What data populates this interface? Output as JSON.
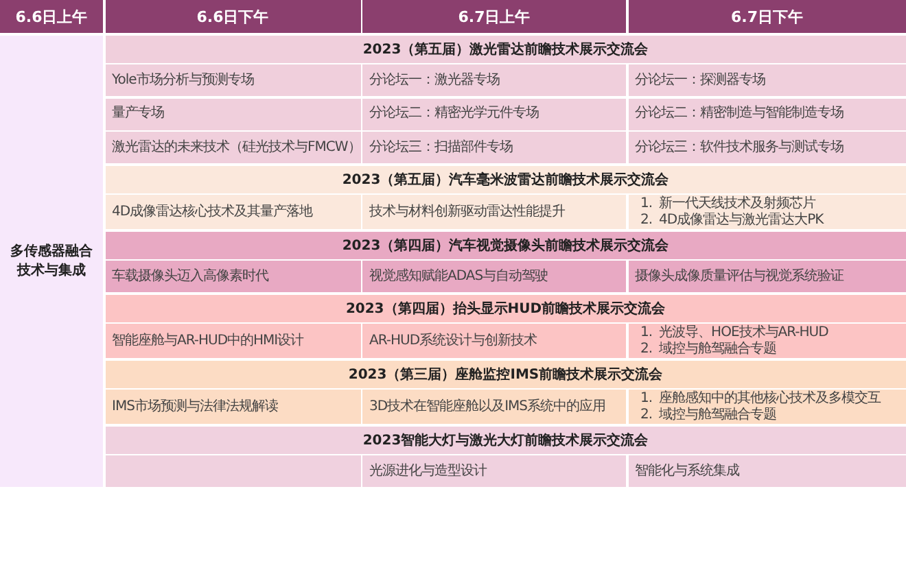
{
  "header": [
    "6.6日上午",
    "6.6日下午",
    "6.7日上午",
    "6.7日下午"
  ],
  "track": "多传感器融合技术与集成",
  "sections": [
    {
      "title": "2023（第五届）激光雷达前瞻技术展示交流会",
      "color": "#f0cfdc",
      "rows": [
        [
          {
            "kind": "text",
            "text": "Yole市场分析与预测专场"
          },
          {
            "kind": "text",
            "text": "分论坛一：激光器专场"
          },
          {
            "kind": "text",
            "text": "分论坛一：探测器专场"
          }
        ],
        [
          {
            "kind": "text",
            "text": "量产专场"
          },
          {
            "kind": "text",
            "text": "分论坛二：精密光学元件专场"
          },
          {
            "kind": "text",
            "text": "分论坛二：精密制造与智能制造专场"
          }
        ],
        [
          {
            "kind": "text",
            "text": "激光雷达的未来技术（硅光技术与FMCW）"
          },
          {
            "kind": "text",
            "text": "分论坛三：扫描部件专场"
          },
          {
            "kind": "text",
            "text": "分论坛三：软件技术服务与测试专场"
          }
        ]
      ]
    },
    {
      "title": "2023（第五届）汽车毫米波雷达前瞻技术展示交流会",
      "color": "#fbe8dc",
      "rows": [
        [
          {
            "kind": "text",
            "text": "4D成像雷达核心技术及其量产落地"
          },
          {
            "kind": "text",
            "text": "技术与材料创新驱动雷达性能提升"
          },
          {
            "kind": "list",
            "items": [
              {
                "num": "1.",
                "text": "新一代天线技术及射频芯片"
              },
              {
                "num": "2.",
                "text": "4D成像雷达与激光雷达大PK"
              }
            ]
          }
        ]
      ]
    },
    {
      "title": "2023（第四届）汽车视觉摄像头前瞻技术展示交流会",
      "color": "#e8a9c3",
      "rows": [
        [
          {
            "kind": "text",
            "text": "车载摄像头迈入高像素时代"
          },
          {
            "kind": "text",
            "text": "视觉感知赋能ADAS与自动驾驶"
          },
          {
            "kind": "text",
            "text": "摄像头成像质量评估与视觉系统验证"
          }
        ]
      ]
    },
    {
      "title": "2023（第四届）抬头显示HUD前瞻技术展示交流会",
      "color": "#fcc4c4",
      "rows": [
        [
          {
            "kind": "text",
            "text": "智能座舱与AR-HUD中的HMI设计"
          },
          {
            "kind": "text",
            "text": "AR-HUD系统设计与创新技术"
          },
          {
            "kind": "list",
            "items": [
              {
                "num": "1.",
                "text": "光波导、HOE技术与AR-HUD"
              },
              {
                "num": "2.",
                "text": "域控与舱驾融合专题"
              }
            ]
          }
        ]
      ]
    },
    {
      "title": "2023（第三届）座舱监控IMS前瞻技术展示交流会",
      "color": "#fcdcc4",
      "rows": [
        [
          {
            "kind": "text",
            "text": "IMS市场预测与法律法规解读"
          },
          {
            "kind": "text",
            "text": "3D技术在智能座舱以及IMS系统中的应用"
          },
          {
            "kind": "list",
            "items": [
              {
                "num": "1.",
                "text": "座舱感知中的其他核心技术及多模交互"
              },
              {
                "num": "2.",
                "text": "域控与舱驾融合专题"
              }
            ]
          }
        ]
      ]
    },
    {
      "title": "2023智能大灯与激光大灯前瞻技术展示交流会",
      "color": "#f0d1df",
      "rows": [
        [
          {
            "kind": "blank"
          },
          {
            "kind": "text",
            "text": "光源进化与造型设计"
          },
          {
            "kind": "text",
            "text": "智能化与系统集成"
          }
        ]
      ]
    }
  ]
}
